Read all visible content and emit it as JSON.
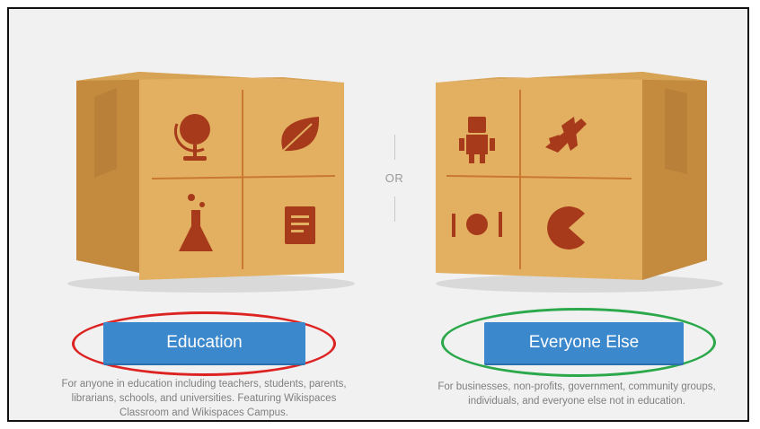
{
  "separator": {
    "label": "OR"
  },
  "education": {
    "button_label": "Education",
    "description": "For anyone in education including teachers, students, parents, librarians, schools, and universities. Featuring Wikispaces Classroom and Wikispaces Campus."
  },
  "everyone_else": {
    "button_label": "Everyone Else",
    "description": "For businesses, non-profits, government, community groups, individuals, and everyone else not in education."
  },
  "annotations": {
    "education_ring_color": "#dd2222",
    "everyone_else_ring_color": "#2aa84a"
  },
  "colors": {
    "button": "#3b88cd",
    "box": "#e4b265",
    "icon": "#a63a1a"
  },
  "icons": {
    "education_box": [
      "globe-icon",
      "leaf-icon",
      "flask-icon",
      "notebook-icon"
    ],
    "everyone_else_box": [
      "robot-icon",
      "airplane-icon",
      "dinner-plate-icon",
      "pacman-icon"
    ]
  }
}
